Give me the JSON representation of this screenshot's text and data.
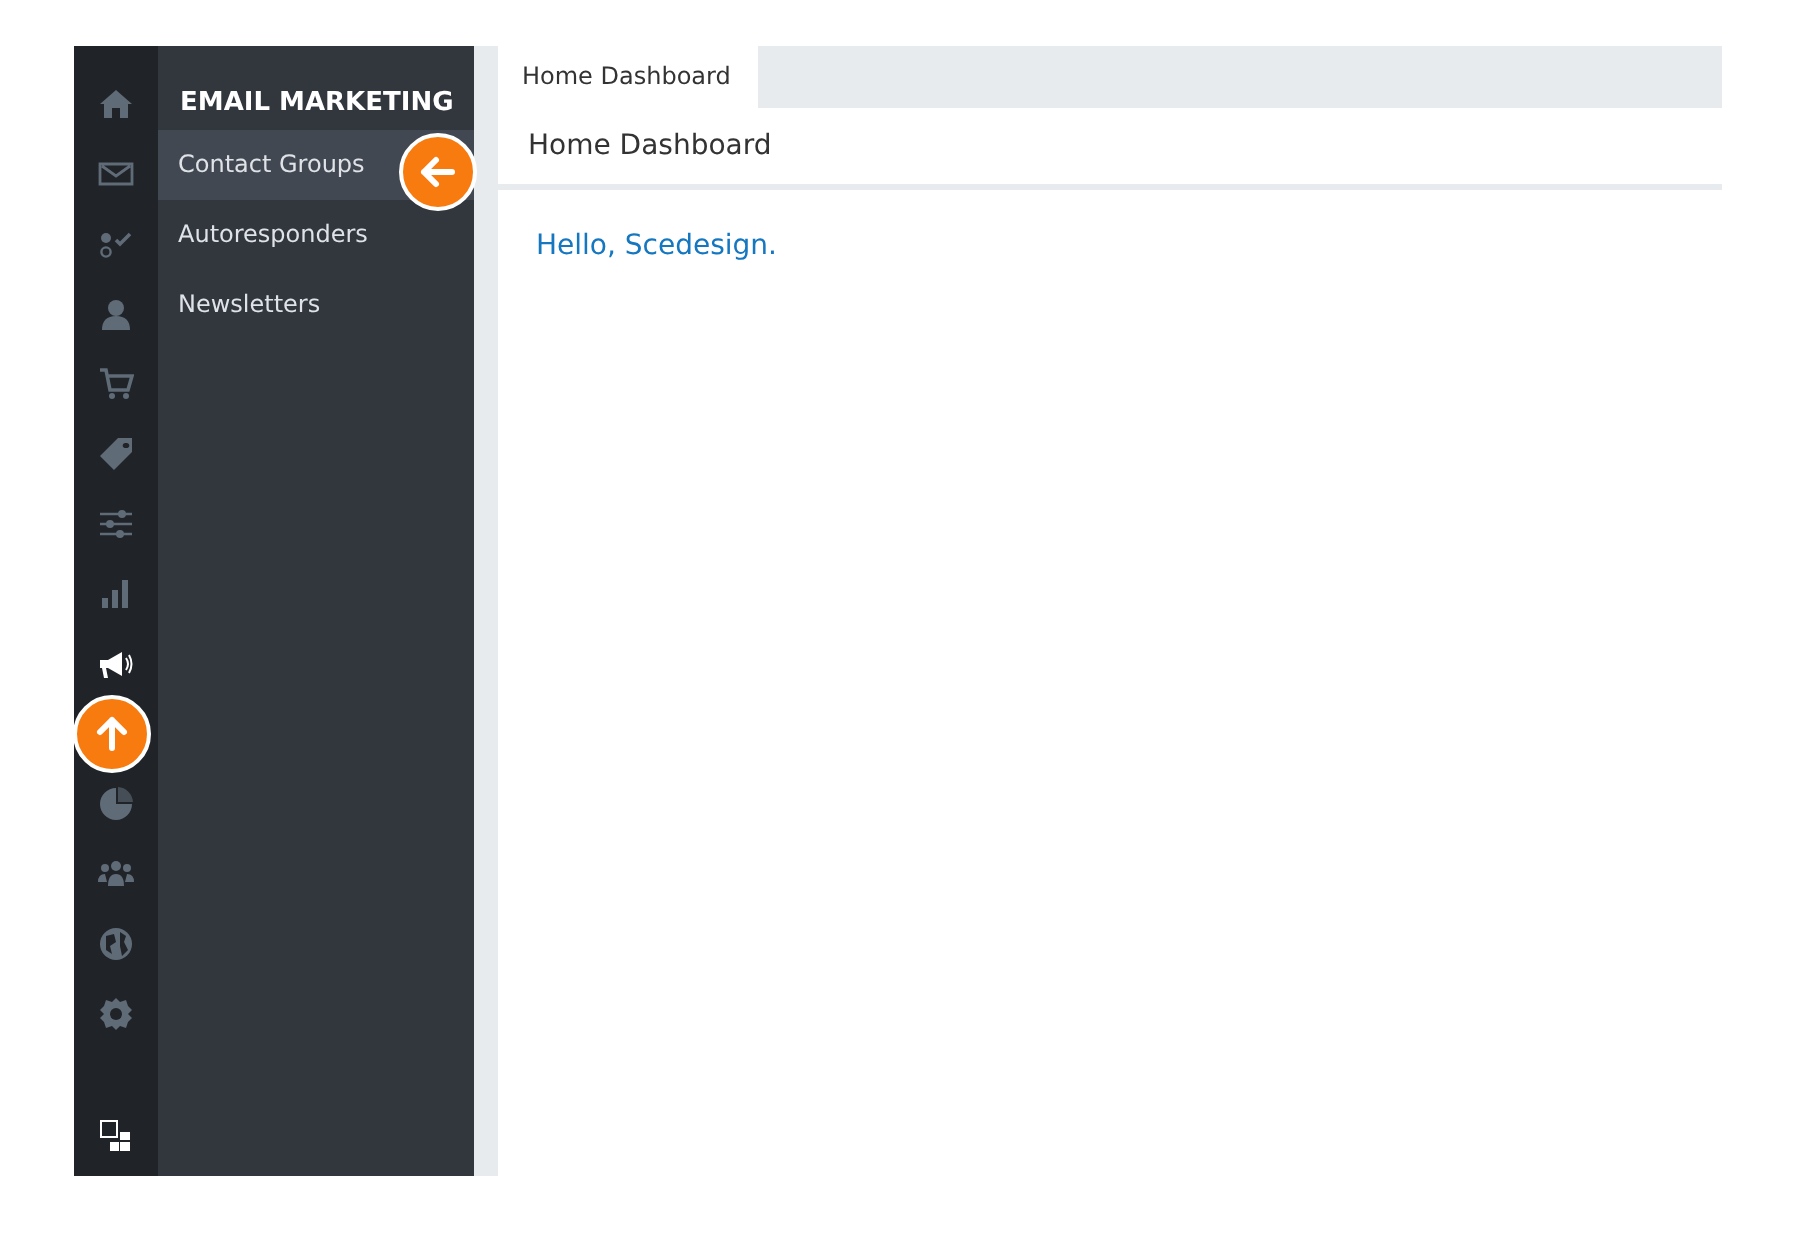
{
  "rail": [
    {
      "kind": "home",
      "selected": false
    },
    {
      "kind": "mail",
      "selected": false
    },
    {
      "kind": "tasks",
      "selected": false
    },
    {
      "kind": "user",
      "selected": false
    },
    {
      "kind": "cart",
      "selected": false
    },
    {
      "kind": "tag",
      "selected": false
    },
    {
      "kind": "sliders",
      "selected": false
    },
    {
      "kind": "bars",
      "selected": false
    },
    {
      "kind": "megaphone",
      "selected": true
    },
    {
      "kind": "callout"
    },
    {
      "kind": "pie",
      "selected": false
    },
    {
      "kind": "team",
      "selected": false
    },
    {
      "kind": "globe",
      "selected": false
    },
    {
      "kind": "gear",
      "selected": false
    }
  ],
  "menu": {
    "title": "EMAIL MARKETING",
    "items": [
      {
        "label": "Contact Groups",
        "selected": true
      },
      {
        "label": "Autoresponders",
        "selected": false
      },
      {
        "label": "Newsletters",
        "selected": false
      }
    ]
  },
  "tabs": [
    {
      "label": "Home Dashboard",
      "selected": true
    }
  ],
  "page": {
    "title": "Home Dashboard",
    "greeting": "Hello, Scedesign."
  }
}
